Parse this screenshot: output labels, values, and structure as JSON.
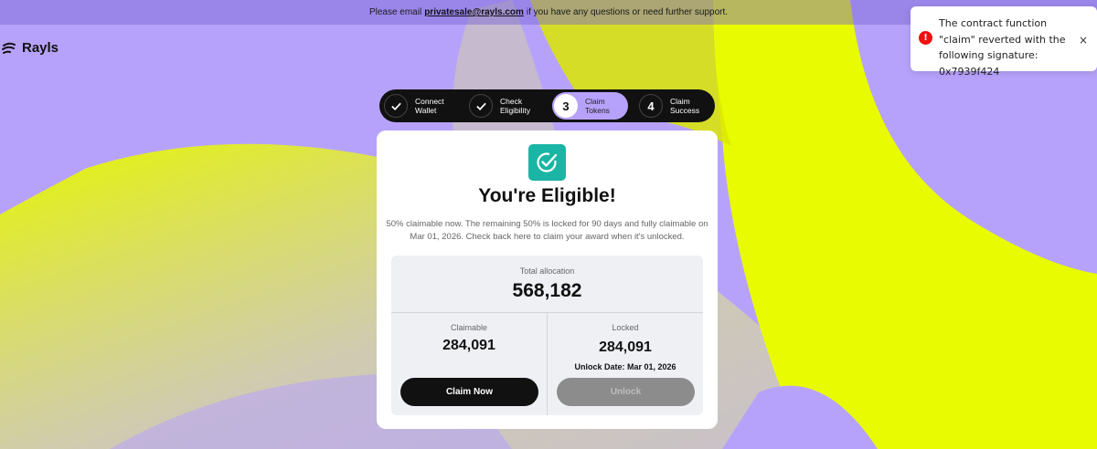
{
  "banner": {
    "prefix": "Please email",
    "email": "privatesale@rayls.com",
    "suffix": "if you have any questions or need further support."
  },
  "logo": {
    "name": "Rayls",
    "icon": "rayls-logo-icon"
  },
  "toast": {
    "type": "error",
    "icon": "error-icon",
    "message": "The contract function \"claim\" reverted with the following signature: 0x7939f424",
    "close_symbol": "×"
  },
  "stepper": {
    "steps": [
      {
        "badge": "",
        "icon": "check-icon",
        "line1": "Connect",
        "line2": "Wallet",
        "state": "done"
      },
      {
        "badge": "",
        "icon": "check-icon",
        "line1": "Check",
        "line2": "Eligibility",
        "state": "done"
      },
      {
        "badge": "3",
        "icon": "",
        "line1": "Claim",
        "line2": "Tokens",
        "state": "active"
      },
      {
        "badge": "4",
        "icon": "",
        "line1": "Claim",
        "line2": "Success",
        "state": "pending"
      }
    ]
  },
  "card": {
    "icon": "checkmark-badge-icon",
    "title": "You're Eligible!",
    "description": "50% claimable now. The remaining 50% is locked for 90 days and fully claimable on Mar 01, 2026. Check back here to claim your award when it's unlocked.",
    "total_label": "Total allocation",
    "total_value": "568,182",
    "claimable_label": "Claimable",
    "claimable_value": "284,091",
    "locked_label": "Locked",
    "locked_value": "284,091",
    "unlock_date": "Unlock Date: Mar 01, 2026",
    "claim_button": "Claim Now",
    "unlock_button": "Unlock"
  },
  "colors": {
    "background_purple": "#b7a2fb",
    "background_yellow": "#e9fb00",
    "accent_teal": "#1ab5a5",
    "error_red": "#ee1111",
    "dark": "#111111"
  }
}
